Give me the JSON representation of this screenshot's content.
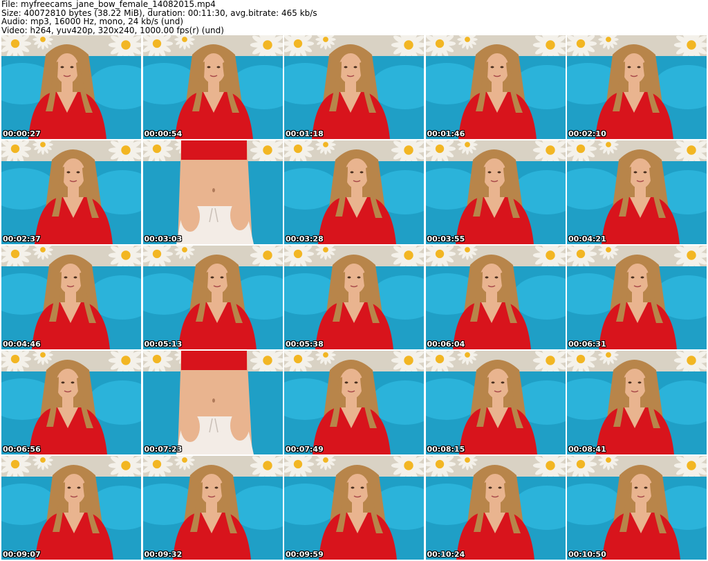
{
  "header": {
    "file_line": "File: myfreecams_jane_bow_female_14082015.mp4",
    "size_line": "Size: 40072810 bytes (38.22 MiB), duration: 00:11:30, avg.bitrate: 465 kb/s",
    "audio_line": "Audio: mp3, 16000 Hz, mono, 24 kb/s (und)",
    "video_line": "Video: h264, yuv420p, 320x240, 1000.00 fps(r) (und)"
  },
  "thumbnails": [
    {
      "time": "00:00:27",
      "scene": "portrait"
    },
    {
      "time": "00:00:54",
      "scene": "portrait-tilt"
    },
    {
      "time": "00:01:18",
      "scene": "portrait"
    },
    {
      "time": "00:01:46",
      "scene": "portrait"
    },
    {
      "time": "00:02:10",
      "scene": "portrait"
    },
    {
      "time": "00:02:37",
      "scene": "portrait"
    },
    {
      "time": "00:03:03",
      "scene": "torso-skirt"
    },
    {
      "time": "00:03:28",
      "scene": "portrait"
    },
    {
      "time": "00:03:55",
      "scene": "portrait"
    },
    {
      "time": "00:04:21",
      "scene": "portrait"
    },
    {
      "time": "00:04:46",
      "scene": "portrait"
    },
    {
      "time": "00:05:13",
      "scene": "portrait"
    },
    {
      "time": "00:05:38",
      "scene": "portrait"
    },
    {
      "time": "00:06:04",
      "scene": "portrait"
    },
    {
      "time": "00:06:31",
      "scene": "portrait"
    },
    {
      "time": "00:06:56",
      "scene": "portrait"
    },
    {
      "time": "00:07:23",
      "scene": "torso-skirt"
    },
    {
      "time": "00:07:49",
      "scene": "portrait"
    },
    {
      "time": "00:08:15",
      "scene": "portrait"
    },
    {
      "time": "00:08:41",
      "scene": "portrait"
    },
    {
      "time": "00:09:07",
      "scene": "portrait"
    },
    {
      "time": "00:09:32",
      "scene": "portrait"
    },
    {
      "time": "00:09:59",
      "scene": "portrait"
    },
    {
      "time": "00:10:24",
      "scene": "portrait"
    },
    {
      "time": "00:10:50",
      "scene": "portrait"
    }
  ],
  "colors": {
    "background": "#ffffff",
    "wall": "#d9d2c4",
    "daisy_petal": "#f4f1ea",
    "daisy_center": "#f2b623",
    "sofa": "#1f9fc6",
    "shirt": "#d8141c",
    "skin": "#e9b48f",
    "hair": "#b8854a",
    "skirt": "#f3ece6",
    "timestamp": "#ffffff"
  }
}
